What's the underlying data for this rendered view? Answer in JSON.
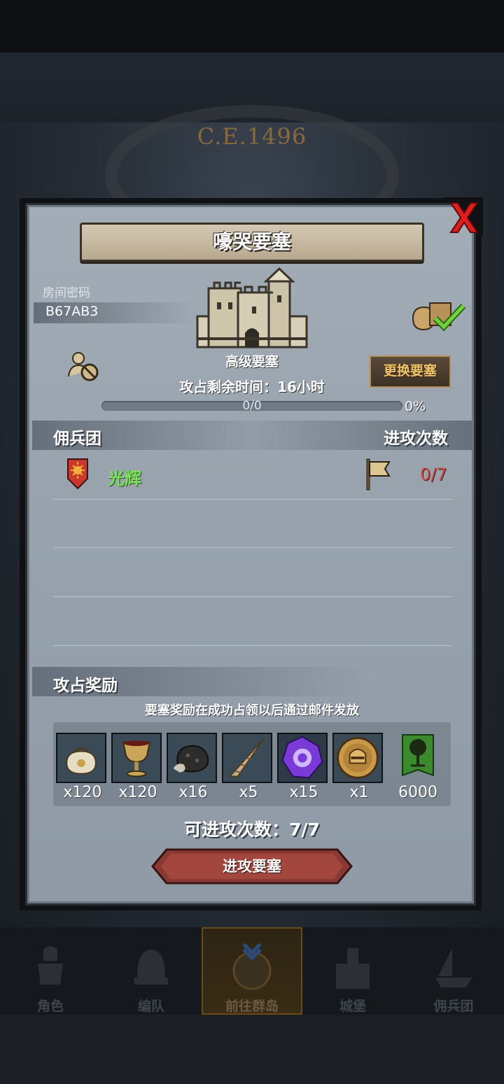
{
  "header": {
    "era": "C.E.1496"
  },
  "modal": {
    "title": "嚎哭要塞",
    "room_label": "房间密码",
    "room_code": "B67AB3",
    "fort_level": "高级要塞",
    "time_left": "攻占剩余时间：16小时",
    "change_button": "更换要塞",
    "progress": {
      "count": "0/0",
      "percent": "0%",
      "fraction": 0
    },
    "merc_header": "佣兵团",
    "attack_header": "进攻次数",
    "guilds": [
      {
        "name": "光辉",
        "attacks": "0/7"
      }
    ],
    "reward_header": "攻占奖励",
    "reward_note": "要塞奖励在成功占领以后通过邮件发放",
    "rewards": [
      {
        "icon": "sack-icon",
        "qty": "x120"
      },
      {
        "icon": "chalice-icon",
        "qty": "x120"
      },
      {
        "icon": "ore-icon",
        "qty": "x16"
      },
      {
        "icon": "horn-icon",
        "qty": "x5"
      },
      {
        "icon": "purple-gem-icon",
        "qty": "x15"
      },
      {
        "icon": "helmet-coin-icon",
        "qty": "x1"
      },
      {
        "icon": "guild-banner-icon",
        "qty": "6000"
      }
    ],
    "attempts": "可进攻次数：7/7",
    "attack_button": "进攻要塞"
  },
  "nav": [
    {
      "label": "角色"
    },
    {
      "label": "编队"
    },
    {
      "label": "前往群岛"
    },
    {
      "label": "城堡"
    },
    {
      "label": "佣兵团"
    }
  ],
  "colors": {
    "guild_name": "#7de05a",
    "attack_count": "#d84a42",
    "change_button_text": "#f2c46a",
    "close_x": "#e01d1d"
  }
}
